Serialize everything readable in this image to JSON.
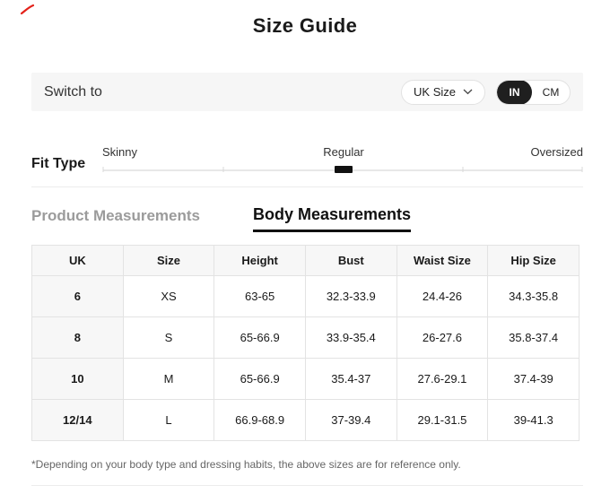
{
  "header": {
    "title": "Size Guide"
  },
  "annotation": {
    "red_pen_mark_color": "#e32119"
  },
  "switch_bar": {
    "label": "Switch to",
    "region_selector": {
      "value": "UK Size",
      "chevron_icon": "chevron-down"
    },
    "unit_toggle": {
      "options": [
        "IN",
        "CM"
      ],
      "selected": "IN"
    }
  },
  "fit_type": {
    "label": "Fit Type",
    "options": [
      "Skinny",
      "Regular",
      "Oversized"
    ],
    "selected": "Regular",
    "selected_index": 1
  },
  "tabs": [
    {
      "label": "Product Measurements",
      "active": false
    },
    {
      "label": "Body Measurements",
      "active": true
    }
  ],
  "size_table": {
    "headers": [
      "UK",
      "Size",
      "Height",
      "Bust",
      "Waist Size",
      "Hip Size"
    ],
    "rows": [
      [
        "6",
        "XS",
        "63-65",
        "32.3-33.9",
        "24.4-26",
        "34.3-35.8"
      ],
      [
        "8",
        "S",
        "65-66.9",
        "33.9-35.4",
        "26-27.6",
        "35.8-37.4"
      ],
      [
        "10",
        "M",
        "65-66.9",
        "35.4-37",
        "27.6-29.1",
        "37.4-39"
      ],
      [
        "12/14",
        "L",
        "66.9-68.9",
        "37-39.4",
        "29.1-31.5",
        "39-41.3"
      ]
    ]
  },
  "footnote": {
    "text": "*Depending on your body type and dressing habits, the above sizes are for reference only."
  },
  "colors": {
    "toggle_selected_bg": "#1f1f1f",
    "bar_bg": "#f6f6f6",
    "table_border": "#e3e3e3",
    "table_head_bg": "#f7f7f7",
    "inactive_tab": "#9b9b9b",
    "footnote_text": "#666666"
  }
}
